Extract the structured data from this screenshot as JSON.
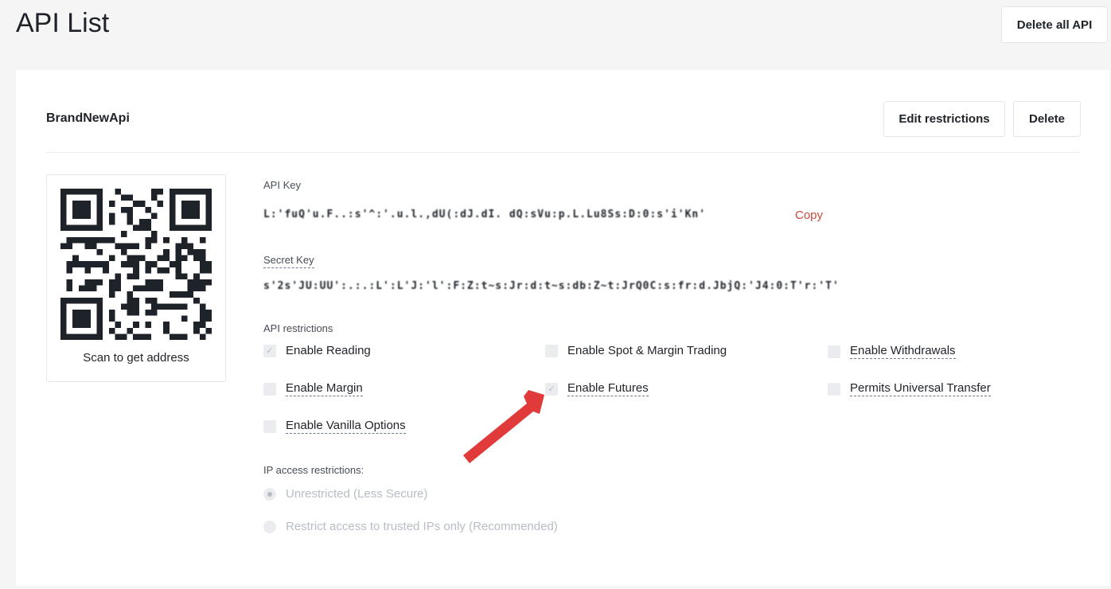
{
  "page": {
    "title": "API List",
    "delete_all_label": "Delete all API"
  },
  "api": {
    "name": "BrandNewApi",
    "edit_label": "Edit restrictions",
    "delete_label": "Delete",
    "qr_caption": "Scan to get address",
    "api_key_label": "API Key",
    "api_key_value": "L:'fuQ'u.F..:s'^:'.u.l.,dU(:dJ.dI. dQ:sVu:p.L.Lu8Ss:D:0:s'i'Kn'",
    "copy_label": "Copy",
    "secret_key_label": "Secret Key",
    "secret_key_value": "s'2s'JU:UU':.:.:L':L'J:'l':F:Z:t~s:Jr:d:t~s:db:Z~t:JrQ0C:s:fr:d.JbjQ:'J4:0:T'r:'T'",
    "restrictions_label": "API restrictions",
    "restrictions": [
      {
        "label": "Enable Reading",
        "checked": true,
        "dashed": false
      },
      {
        "label": "Enable Spot & Margin Trading",
        "checked": false,
        "dashed": false
      },
      {
        "label": "Enable Withdrawals",
        "checked": false,
        "dashed": true
      },
      {
        "label": "Enable Margin",
        "checked": false,
        "dashed": true
      },
      {
        "label": "Enable Futures",
        "checked": true,
        "dashed": true
      },
      {
        "label": "Permits Universal Transfer",
        "checked": false,
        "dashed": true
      },
      {
        "label": "Enable Vanilla Options",
        "checked": false,
        "dashed": true
      }
    ],
    "ip_label": "IP access restrictions:",
    "ip_options": [
      {
        "label": "Unrestricted (Less Secure)",
        "selected": true
      },
      {
        "label": "Restrict access to trusted IPs only (Recommended)",
        "selected": false
      }
    ]
  },
  "colors": {
    "accent_red": "#c94b3a",
    "arrow": "#e03a3a",
    "disabled": "#b7bdc6"
  },
  "icons": {
    "check": "check-icon",
    "arrow": "annotation-arrow-icon"
  }
}
